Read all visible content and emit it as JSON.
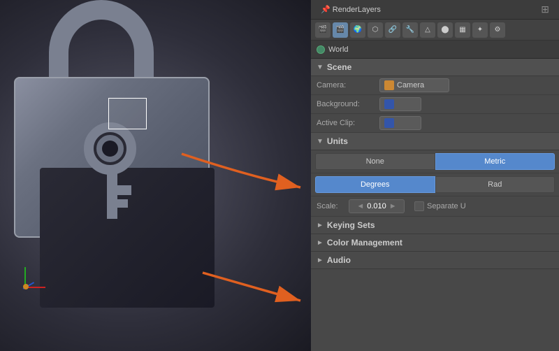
{
  "tabs": {
    "render_layers": "RenderLayers",
    "world": "World"
  },
  "properties_icons": [
    "camera",
    "scene",
    "object",
    "mesh",
    "material",
    "texture",
    "particle",
    "physics",
    "constraints",
    "modifier",
    "data",
    "bone"
  ],
  "scene_section": {
    "title": "Scene",
    "camera_label": "Camera:",
    "camera_value": "Camera",
    "background_label": "Background:",
    "active_clip_label": "Active Clip:"
  },
  "units_section": {
    "title": "Units",
    "none_label": "None",
    "metric_label": "Metric",
    "degrees_label": "Degrees",
    "radians_label": "Rad",
    "scale_label": "Scale:",
    "scale_value": "0.010",
    "separate_label": "Separate U"
  },
  "keying_sets": {
    "title": "Keying Sets"
  },
  "color_management": {
    "title": "Color Management"
  },
  "audio": {
    "title": "Audio"
  },
  "viewport": {
    "axis_x": "X",
    "axis_y": "Y",
    "axis_z": "Z"
  }
}
